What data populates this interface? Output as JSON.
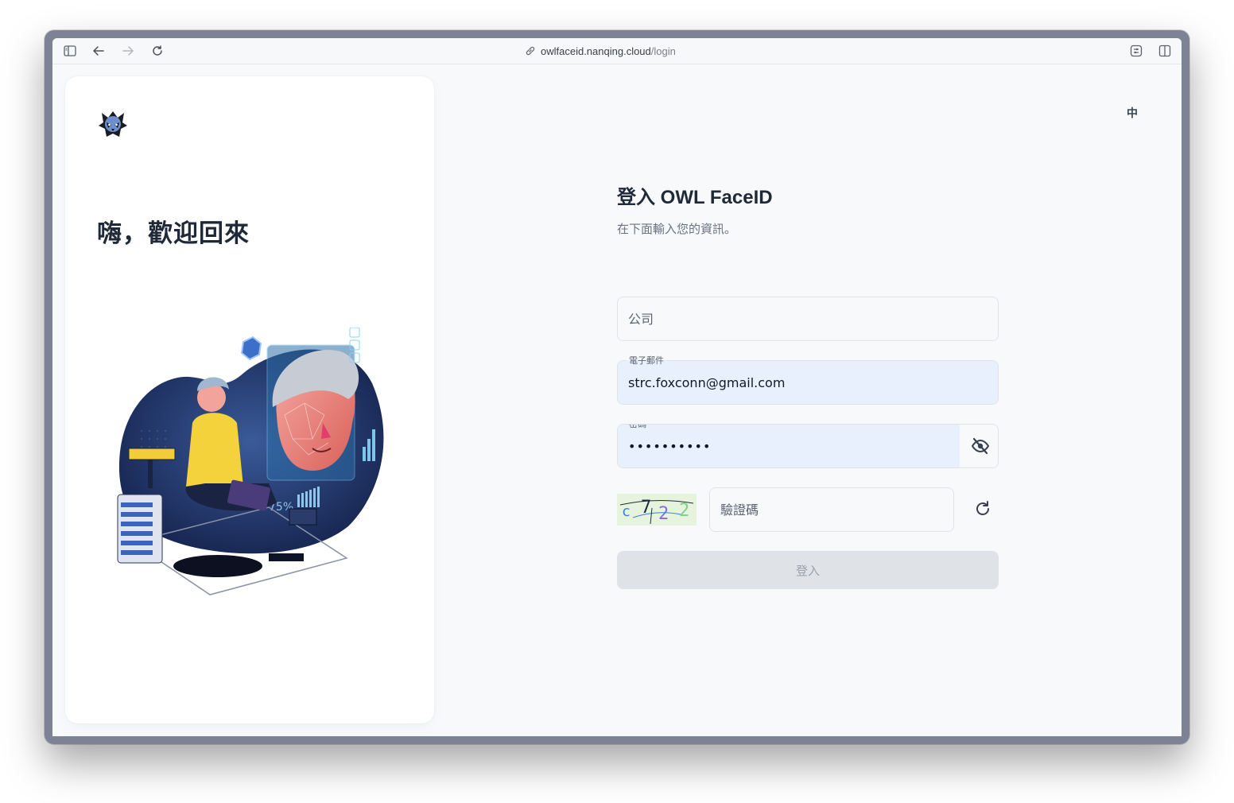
{
  "browser": {
    "url_host": "owlfaceid.nanqing.cloud",
    "url_path": "/login"
  },
  "left_panel": {
    "welcome": "嗨，歡迎回來",
    "illustration_label": "75%"
  },
  "language_toggle": "中",
  "form": {
    "title": "登入 OWL FaceID",
    "subtitle": "在下面輸入您的資訊。",
    "company": {
      "placeholder": "公司",
      "value": ""
    },
    "email": {
      "label": "電子郵件",
      "value": "strc.foxconn@gmail.com"
    },
    "password": {
      "label": "密碼",
      "value": "••••••••••"
    },
    "captcha": {
      "image_text": "c72 2",
      "placeholder": "驗證碼"
    },
    "submit_label": "登入"
  },
  "colors": {
    "accent_blue": "#e8f0fe",
    "disabled_button": "#dfe3e8",
    "heading": "#1f2937"
  }
}
